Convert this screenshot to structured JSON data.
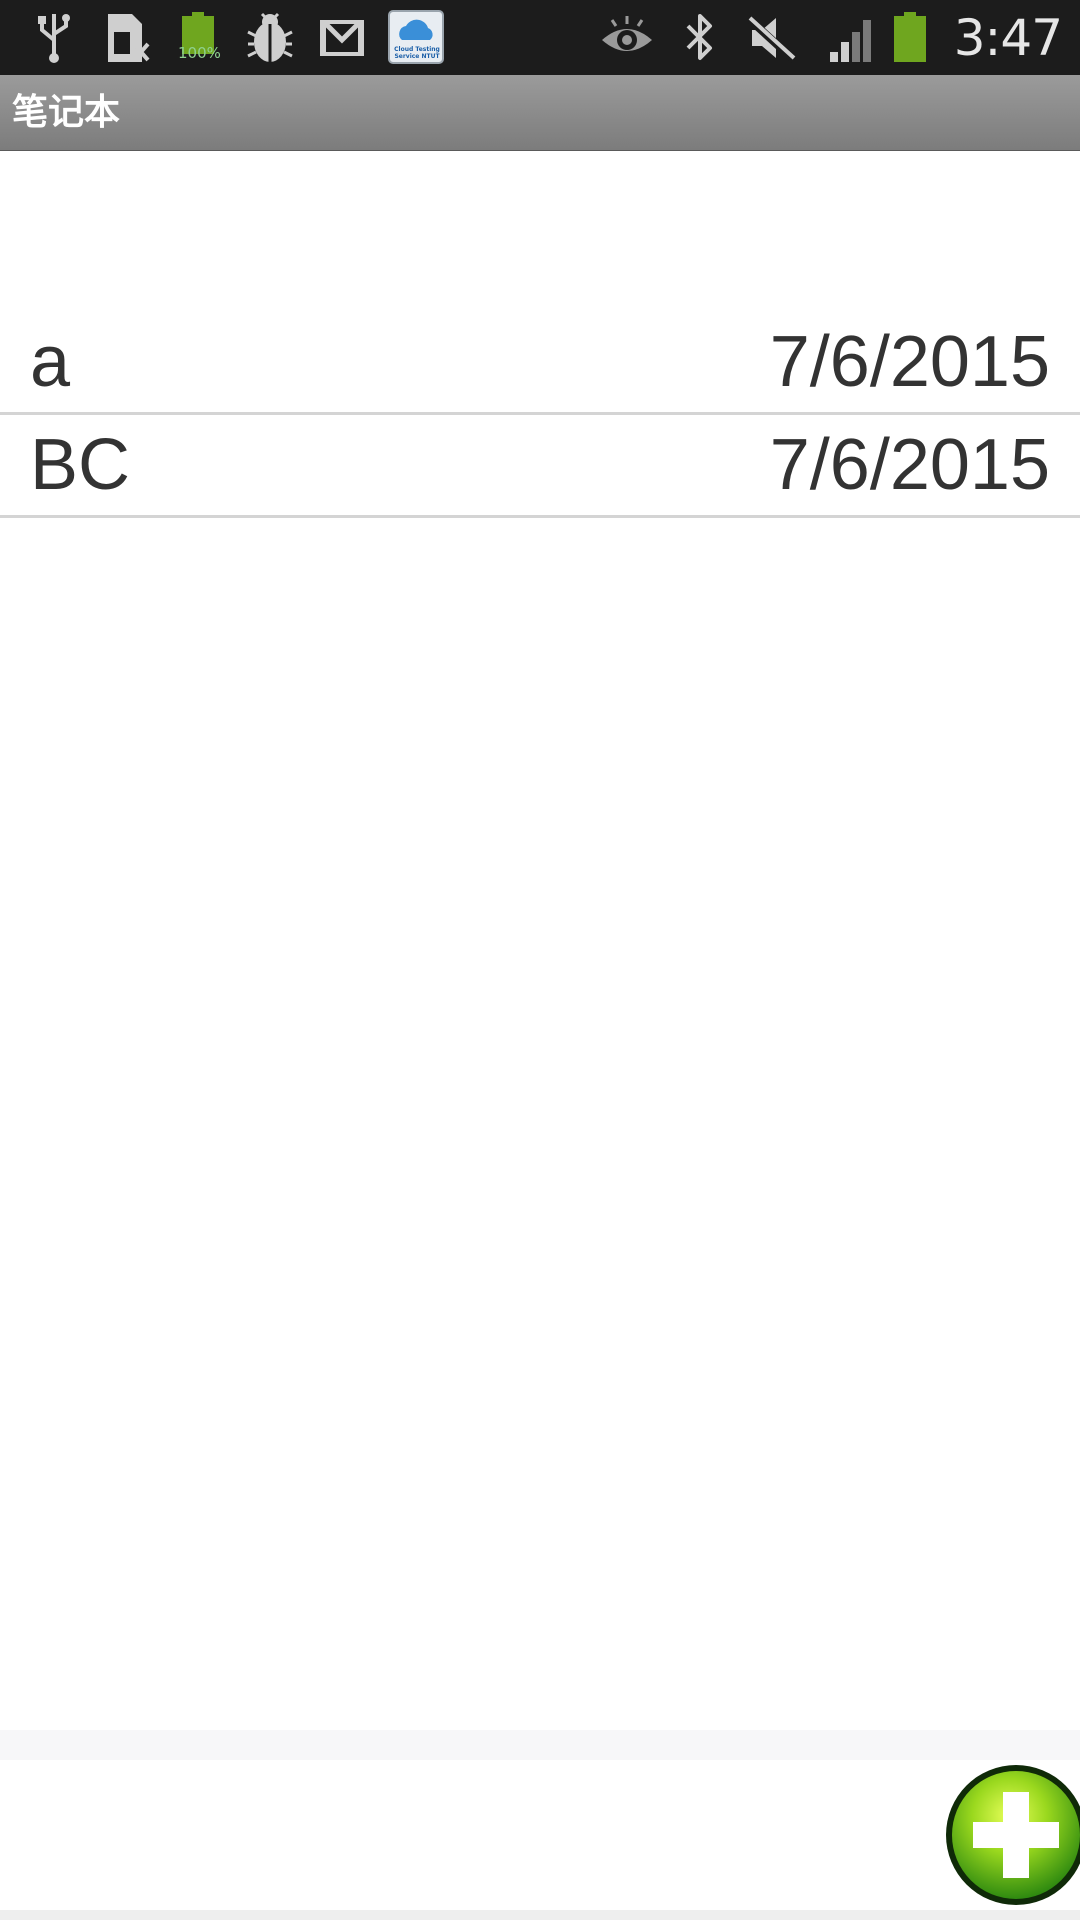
{
  "status_bar": {
    "time": "3:47",
    "battery_percent_label": "100%",
    "cloud_app_label": "Cloud Testing Service NTUT",
    "icons": [
      "usb-icon",
      "sim-card-error-icon",
      "battery-full-icon",
      "debug-bug-icon",
      "gmail-icon",
      "cloud-testing-icon",
      "eye-icon",
      "bluetooth-icon",
      "mute-icon",
      "signal-icon",
      "battery-icon"
    ]
  },
  "action_bar": {
    "title": "笔记本"
  },
  "notes": [
    {
      "title": "a",
      "date": "7/6/2015"
    },
    {
      "title": "BC",
      "date": "7/6/2015"
    }
  ],
  "bottom_bar": {
    "add_icon": "plus-icon"
  },
  "colors": {
    "status_bar_bg": "#1c1c1c",
    "action_bar_bg": "#8a8a8a",
    "battery_green": "#6fa61f",
    "add_button_green": "#7ed321"
  }
}
